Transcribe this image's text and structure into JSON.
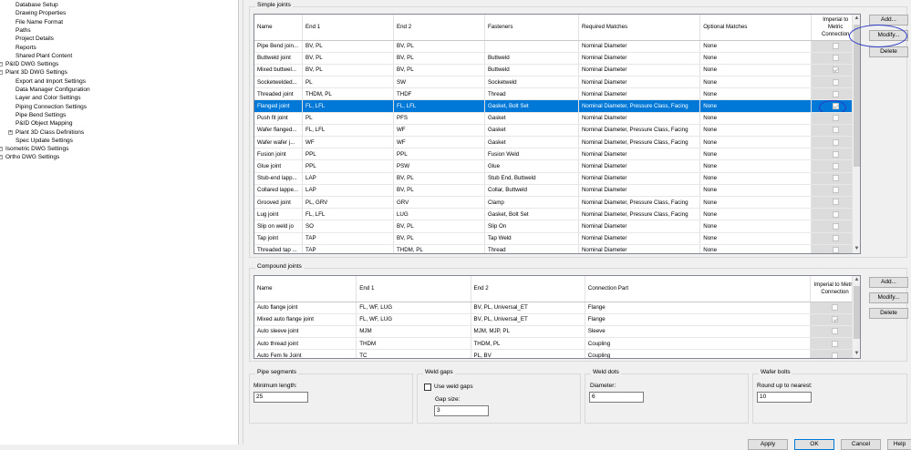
{
  "tree": {
    "items": [
      {
        "label": "Database Setup",
        "indent": 2
      },
      {
        "label": "Drawing Properties",
        "indent": 2
      },
      {
        "label": "File Name Format",
        "indent": 2
      },
      {
        "label": "Paths",
        "indent": 2
      },
      {
        "label": "Project Details",
        "indent": 2
      },
      {
        "label": "Reports",
        "indent": 2
      },
      {
        "label": "Shared Plant Content",
        "indent": 2
      },
      {
        "label": "P&ID DWG Settings",
        "indent": 0
      },
      {
        "label": "Plant 3D DWG Settings",
        "indent": 0
      },
      {
        "label": "Export and Import Settings",
        "indent": 2
      },
      {
        "label": "Data Manager Configuration",
        "indent": 2
      },
      {
        "label": "Layer and Color Settings",
        "indent": 2
      },
      {
        "label": "Piping Connection Settings",
        "indent": 2
      },
      {
        "label": "Pipe Bend Settings",
        "indent": 2
      },
      {
        "label": "P&ID Object Mapping",
        "indent": 2
      },
      {
        "label": "Plant 3D Class Definitions",
        "indent": 1
      },
      {
        "label": "Spec Update Settings",
        "indent": 2
      },
      {
        "label": "Isometric DWG Settings",
        "indent": 0
      },
      {
        "label": "Ortho DWG Settings",
        "indent": 0
      }
    ]
  },
  "simple": {
    "title": "Simple joints",
    "columns": [
      "Name",
      "End 1",
      "End 2",
      "Fasteners",
      "Required Matches",
      "Optional Matches",
      "Imperial to Metric Connection"
    ],
    "rows": [
      {
        "name": "Pipe Bend join...",
        "end1": "BV, PL",
        "end2": "BV, PL",
        "fasteners": "",
        "required": "Nominal Diameter",
        "optional": "None",
        "checked": false,
        "selected": false
      },
      {
        "name": "Buttweld joint",
        "end1": "BV, PL",
        "end2": "BV, PL",
        "fasteners": "Buttweld",
        "required": "Nominal Diameter",
        "optional": "None",
        "checked": false,
        "selected": false
      },
      {
        "name": "Mixed buttwel...",
        "end1": "BV, PL",
        "end2": "BV, PL",
        "fasteners": "Buttweld",
        "required": "Nominal Diameter",
        "optional": "None",
        "checked": true,
        "selected": false
      },
      {
        "name": "Socketwelded...",
        "end1": "PL",
        "end2": "SW",
        "fasteners": "Socketweld",
        "required": "Nominal Diameter",
        "optional": "None",
        "checked": false,
        "selected": false
      },
      {
        "name": "Threaded joint",
        "end1": "THDM, PL",
        "end2": "THDF",
        "fasteners": "Thread",
        "required": "Nominal Diameter",
        "optional": "None",
        "checked": false,
        "selected": false
      },
      {
        "name": "Flanged joint",
        "end1": "FL, LFL",
        "end2": "FL, LFL",
        "fasteners": "Gasket, Bolt Set",
        "required": "Nominal Diameter, Pressure Class, Facing",
        "optional": "None",
        "checked": true,
        "selected": true
      },
      {
        "name": "Push fit joint",
        "end1": "PL",
        "end2": "PFS",
        "fasteners": "Gasket",
        "required": "Nominal Diameter",
        "optional": "None",
        "checked": false,
        "selected": false
      },
      {
        "name": "Wafer flanged...",
        "end1": "FL, LFL",
        "end2": "WF",
        "fasteners": "Gasket",
        "required": "Nominal Diameter, Pressure Class, Facing",
        "optional": "None",
        "checked": false,
        "selected": false
      },
      {
        "name": "Wafer wafer j...",
        "end1": "WF",
        "end2": "WF",
        "fasteners": "Gasket",
        "required": "Nominal Diameter, Pressure Class, Facing",
        "optional": "None",
        "checked": false,
        "selected": false
      },
      {
        "name": "Fusion joint",
        "end1": "PPL",
        "end2": "PPL",
        "fasteners": "Fusion Weld",
        "required": "Nominal Diameter",
        "optional": "None",
        "checked": false,
        "selected": false
      },
      {
        "name": "Glue joint",
        "end1": "PPL",
        "end2": "PSW",
        "fasteners": "Glue",
        "required": "Nominal Diameter",
        "optional": "None",
        "checked": false,
        "selected": false
      },
      {
        "name": "Stub-end lapp...",
        "end1": "LAP",
        "end2": "BV, PL",
        "fasteners": "Stub End, Buttweld",
        "required": "Nominal Diameter",
        "optional": "None",
        "checked": false,
        "selected": false
      },
      {
        "name": "Collared lappe...",
        "end1": "LAP",
        "end2": "BV, PL",
        "fasteners": "Collar, Buttweld",
        "required": "Nominal Diameter",
        "optional": "None",
        "checked": false,
        "selected": false
      },
      {
        "name": "Grooved joint",
        "end1": "PL, GRV",
        "end2": "GRV",
        "fasteners": "Clamp",
        "required": "Nominal Diameter, Pressure Class, Facing",
        "optional": "None",
        "checked": false,
        "selected": false
      },
      {
        "name": "Lug joint",
        "end1": "FL, LFL",
        "end2": "LUG",
        "fasteners": "Gasket, Bolt Set",
        "required": "Nominal Diameter, Pressure Class, Facing",
        "optional": "None",
        "checked": false,
        "selected": false
      },
      {
        "name": "Slip on weld jo",
        "end1": "SO",
        "end2": "BV, PL",
        "fasteners": "Slip On",
        "required": "Nominal Diameter",
        "optional": "None",
        "checked": false,
        "selected": false
      },
      {
        "name": "Tap joint",
        "end1": "TAP",
        "end2": "BV, PL",
        "fasteners": "Tap Weld",
        "required": "Nominal Diameter",
        "optional": "None",
        "checked": false,
        "selected": false
      },
      {
        "name": "Threaded tap ...",
        "end1": "TAP",
        "end2": "THDM, PL",
        "fasteners": "Thread",
        "required": "Nominal Diameter",
        "optional": "None",
        "checked": false,
        "selected": false
      }
    ],
    "buttons": {
      "add": "Add...",
      "modify": "Modify...",
      "delete": "Delete"
    }
  },
  "compound": {
    "title": "Compound joints",
    "columns": [
      "Name",
      "End 1",
      "End 2",
      "Connection Part",
      "Imperial to Metric Connection"
    ],
    "rows": [
      {
        "name": "Auto flange joint",
        "end1": "FL, WF, LUG",
        "end2": "BV, PL, Universal_ET",
        "part": "Flange",
        "checked": false
      },
      {
        "name": "Mixed auto flange joint",
        "end1": "FL, WF, LUG",
        "end2": "BV, PL, Universal_ET",
        "part": "Flange",
        "checked": true
      },
      {
        "name": "Auto sleeve joint",
        "end1": "MJM",
        "end2": "MJM, MJP, PL",
        "part": "Sleeve",
        "checked": false
      },
      {
        "name": "Auto thread joint",
        "end1": "THDM",
        "end2": "THDM, PL",
        "part": "Coupling",
        "checked": false
      },
      {
        "name": "Auto Fem fe Joint",
        "end1": "TC",
        "end2": "PL, BV",
        "part": "Coupling",
        "checked": false
      }
    ],
    "buttons": {
      "add": "Add...",
      "modify": "Modify...",
      "delete": "Delete"
    }
  },
  "pipe_segments": {
    "title": "Pipe segments",
    "label": "Minimum length:",
    "value": "25"
  },
  "weld_gaps": {
    "title": "Weld gaps",
    "checkbox_label": "Use weld gaps",
    "gap_label": "Gap size:",
    "value": "3"
  },
  "weld_dots": {
    "title": "Weld dots",
    "label": "Diameter:",
    "value": "6"
  },
  "wafer_bolts": {
    "title": "Wafer bolts",
    "label": "Round up to nearest:",
    "value": "10"
  },
  "dialog_buttons": [
    "Apply",
    "OK",
    "Cancel",
    "Help"
  ],
  "colors": {
    "selection": "#0078d7",
    "annotation": "#2b39c7"
  }
}
